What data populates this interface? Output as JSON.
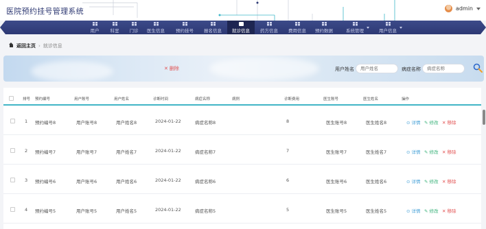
{
  "header": {
    "title": "医院预约挂号管理系统",
    "username": "admin"
  },
  "nav": [
    {
      "label": "用户",
      "active": false
    },
    {
      "label": "科室",
      "active": false
    },
    {
      "label": "门诊",
      "active": false
    },
    {
      "label": "医生信息",
      "active": false
    },
    {
      "label": "预约挂号",
      "active": false
    },
    {
      "label": "报名信息",
      "active": false
    },
    {
      "label": "就诊信息",
      "active": true
    },
    {
      "label": "药方信息",
      "active": false
    },
    {
      "label": "费用信息",
      "active": false
    },
    {
      "label": "预约数据",
      "active": false
    },
    {
      "label": "系统管理",
      "active": false
    },
    {
      "label": "用户信息",
      "active": false
    }
  ],
  "breadcrumb": {
    "home": "返回主页",
    "separator": "›",
    "current": "就诊信息"
  },
  "search": {
    "delete_label": "删除",
    "user_name_label": "用户姓名",
    "user_name_placeholder": "用户姓名",
    "disease_label": "病症名称",
    "disease_placeholder": "病症名称"
  },
  "table": {
    "headers": [
      "排号",
      "预约编号",
      "用户账号",
      "用户姓名",
      "诊断时间",
      "病症名称",
      "病例",
      "诊断费用",
      "医生账号",
      "医生姓名",
      "操作"
    ],
    "rows": [
      {
        "no": "1",
        "booking": "预约编号8",
        "account": "用户账号8",
        "name": "用户姓名8",
        "date": "2024-01-22",
        "disease": "病症名称8",
        "fee": "8",
        "doctor_acct": "医生账号8",
        "doctor_name": "医生姓名8"
      },
      {
        "no": "2",
        "booking": "预约编号7",
        "account": "用户账号7",
        "name": "用户姓名7",
        "date": "2024-01-22",
        "disease": "病症名称7",
        "fee": "7",
        "doctor_acct": "医生账号7",
        "doctor_name": "医生姓名7"
      },
      {
        "no": "3",
        "booking": "预约编号6",
        "account": "用户账号6",
        "name": "用户姓名6",
        "date": "2024-01-22",
        "disease": "病症名称6",
        "fee": "6",
        "doctor_acct": "医生账号6",
        "doctor_name": "医生姓名6"
      },
      {
        "no": "4",
        "booking": "预约编号5",
        "account": "用户账号5",
        "name": "用户姓名5",
        "date": "2024-01-22",
        "disease": "病症名称5",
        "fee": "5",
        "doctor_acct": "医生账号5",
        "doctor_name": "医生姓名5"
      }
    ],
    "actions": {
      "view": "详情",
      "edit": "修改",
      "remove": "移除"
    }
  },
  "colors": {
    "nav_bg": "#2d3974",
    "nav_active": "#1e2652",
    "accent_line": "#40b5c6",
    "danger": "#e25252",
    "success": "#3ab27a",
    "link": "#4aa3d8"
  }
}
